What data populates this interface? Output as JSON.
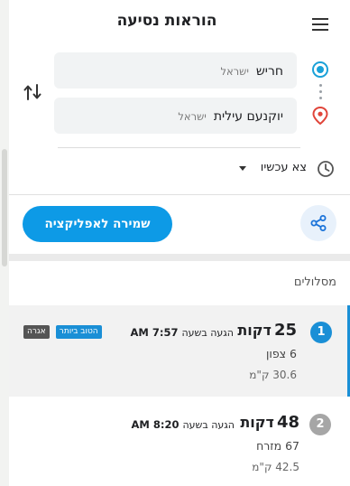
{
  "header": {
    "title": "הוראות נסיעה"
  },
  "origin": {
    "name": "חריש",
    "country": "ישראל"
  },
  "destination": {
    "name": "יוקנעם עילית",
    "country": "ישראל"
  },
  "depart": {
    "label": "צא עכשיו"
  },
  "actions": {
    "save_label": "שמירה לאפליקציה"
  },
  "routes": {
    "heading": "מסלולים",
    "items": [
      {
        "index": "1",
        "duration": "25",
        "unit": "דקות",
        "arrival_label": "הגעה בשעה",
        "arrival_time": "7:57 AM",
        "line": "6 צפון",
        "distance": "30.6 ק\"מ",
        "badges": [
          "אגרה",
          "הטוב ביותר"
        ]
      },
      {
        "index": "2",
        "duration": "48",
        "unit": "דקות",
        "arrival_label": "הגעה בשעה",
        "arrival_time": "8:20 AM",
        "line": "67 מזרח",
        "distance": "42.5 ק\"מ"
      }
    ]
  },
  "colors": {
    "accent": "#0d9ae6",
    "route_selected": "#1a8fd6",
    "destination_pin": "#e0453a",
    "origin_ring": "#1aa1d8"
  },
  "icons": [
    "menu-icon",
    "swap-icon",
    "origin-icon",
    "destination-pin-icon",
    "clock-icon",
    "share-icon"
  ]
}
